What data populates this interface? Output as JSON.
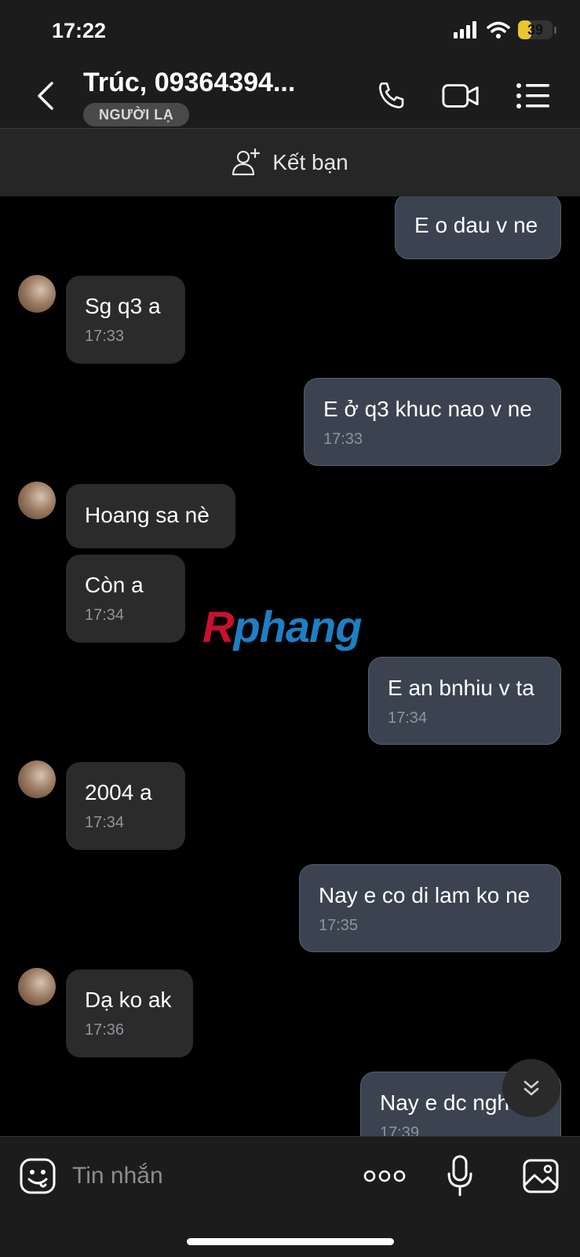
{
  "status_bar": {
    "time": "17:22",
    "battery_level": "39",
    "battery_color": "#e7c630"
  },
  "header": {
    "contact_name": "Trúc, 09364394...",
    "badge": "NGƯỜI LẠ"
  },
  "friend_bar": {
    "label": "Kết bạn"
  },
  "messages": [
    {
      "dir": "sent",
      "text": "E o dau v ne"
    },
    {
      "dir": "received",
      "text": "Sg q3 a",
      "time": "17:33"
    },
    {
      "dir": "sent",
      "text": "E ở q3 khuc nao v ne",
      "time": "17:33"
    },
    {
      "dir": "received",
      "text": "Hoang sa nè"
    },
    {
      "dir": "received",
      "text": "Còn a",
      "time": "17:34"
    },
    {
      "dir": "sent",
      "text": "E an bnhiu v ta",
      "time": "17:34"
    },
    {
      "dir": "received",
      "text": "2004 a",
      "time": "17:34"
    },
    {
      "dir": "sent",
      "text": "Nay e co di lam ko ne",
      "time": "17:35"
    },
    {
      "dir": "received",
      "text": "Dạ ko ak",
      "time": "17:36"
    },
    {
      "dir": "sent",
      "text": "Nay e dc ngh",
      "time": "17:39"
    }
  ],
  "watermark": {
    "part1": "R",
    "part2": "phang"
  },
  "input": {
    "placeholder": "Tin nhắn"
  },
  "colors": {
    "sent_bubble": "#3b4350",
    "received_bubble": "#2b2b2b",
    "background": "#000000"
  },
  "icons": [
    "back-chevron-icon",
    "phone-icon",
    "video-call-icon",
    "menu-list-icon",
    "add-friend-icon",
    "scroll-down-icon",
    "sticker-icon",
    "more-icon",
    "microphone-icon",
    "gallery-icon"
  ]
}
